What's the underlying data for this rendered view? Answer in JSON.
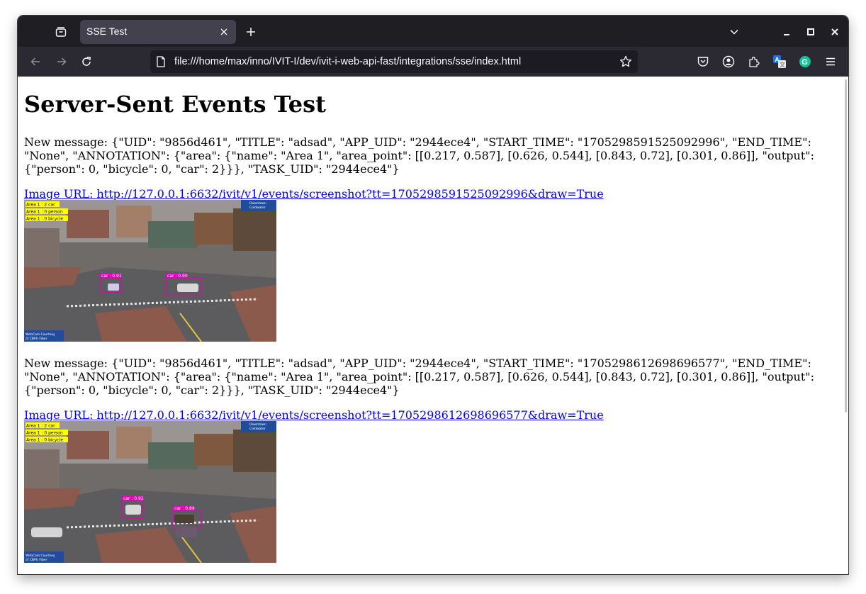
{
  "browser": {
    "tab_title": "SSE Test",
    "url": "file:///home/max/inno/IVIT-I/dev/ivit-i-web-api-fast/integrations/sse/index.html",
    "colors": {
      "tabbar": "#1f1e23",
      "toolbar": "#2b2a33",
      "urlbar": "#1c1b22",
      "link": "#0000ee"
    },
    "icons": [
      "tab-list-icon",
      "close-icon",
      "plus-icon",
      "chevron-down-icon",
      "minimize-icon",
      "maximize-icon",
      "back-icon",
      "forward-icon",
      "reload-icon",
      "page-icon",
      "star-icon",
      "pocket-icon",
      "account-icon",
      "extensions-icon",
      "translate-icon",
      "grammarly-icon",
      "menu-icon"
    ]
  },
  "page": {
    "heading": "Server-Sent Events Test",
    "events": [
      {
        "message": "New message: {\"UID\": \"9856d461\", \"TITLE\": \"adsad\", \"APP_UID\": \"2944ece4\", \"START_TIME\": \"1705298591525092996\", \"END_TIME\": \"None\", \"ANNOTATION\": {\"area\": {\"name\": \"Area 1\", \"area_point\": [[0.217, 0.587], [0.626, 0.544], [0.843, 0.72], [0.301, 0.86]], \"output\": {\"person\": 0, \"bicycle\": 0, \"car\": 2}}}, \"TASK_UID\": \"2944ece4\"}",
        "image_link": "Image URL: http://127.0.0.1:6632/ivit/v1/events/screenshot?tt=1705298591525092996&draw=True",
        "overlay": {
          "counts": [
            "Area 1 : 2 car",
            "Area 1 : 0 person",
            "Area 1 : 0 bicycle"
          ],
          "detections": [
            "car : 0.91",
            "car : 0.90"
          ],
          "badge": [
            "Downtown",
            "Coldwater"
          ],
          "credit": [
            "WebCam Courtesy",
            "of CBPU Fiber"
          ]
        }
      },
      {
        "message": "New message: {\"UID\": \"9856d461\", \"TITLE\": \"adsad\", \"APP_UID\": \"2944ece4\", \"START_TIME\": \"1705298612698696577\", \"END_TIME\": \"None\", \"ANNOTATION\": {\"area\": {\"name\": \"Area 1\", \"area_point\": [[0.217, 0.587], [0.626, 0.544], [0.843, 0.72], [0.301, 0.86]], \"output\": {\"person\": 0, \"bicycle\": 0, \"car\": 2}}}, \"TASK_UID\": \"2944ece4\"}",
        "image_link": "Image URL: http://127.0.0.1:6632/ivit/v1/events/screenshot?tt=1705298612698696577&draw=True",
        "overlay": {
          "counts": [
            "Area 1 : 2 car",
            "Area 1 : 0 person",
            "Area 1 : 0 bicycle"
          ],
          "detections": [
            "car : 0.92",
            "car : 0.89"
          ],
          "badge": [
            "Downtown",
            "Coldwater"
          ],
          "credit": [
            "WebCam Courtesy",
            "of CBPU Fiber"
          ]
        }
      }
    ]
  }
}
